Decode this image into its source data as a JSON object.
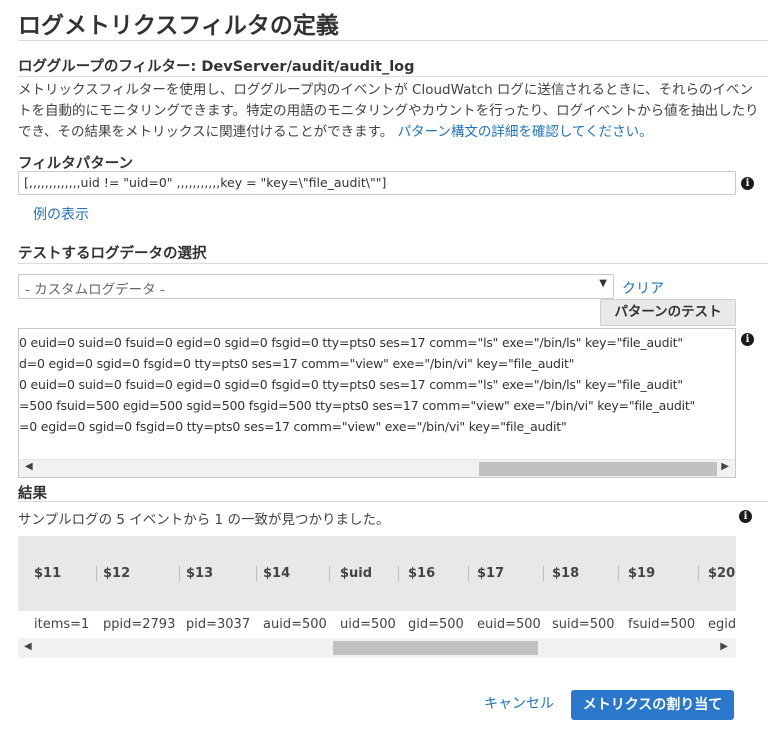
{
  "title": "ログメトリクスフィルタの定義",
  "filter_header": "ロググループのフィルター: DevServer/audit/audit_log",
  "description": "メトリックスフィルターを使用し、ロググループ内のイベントが CloudWatch ログに送信されるときに、それらのイベントを自動的にモニタリングできます。特定の用語のモニタリングやカウントを行ったり、ログイベントから値を抽出したりでき、その結果をメトリックスに関連付けることができます。",
  "description_link": "パターン構文の詳細を確認してください。",
  "filter_pattern": {
    "label": "フィルタパターン",
    "value": "[,,,,,,,,,,,,,uid != \"uid=0\" ,,,,,,,,,,,key = \"key=\\\"file_audit\\\"\"]",
    "examples_link": "例の表示"
  },
  "test_section": {
    "label": "テストするログデータの選択",
    "select_value": "- カスタムログデータ -",
    "clear_link": "クリア",
    "test_button": "パターンのテスト",
    "log_lines": [
      "0 euid=0 suid=0 fsuid=0 egid=0 sgid=0 fsgid=0 tty=pts0 ses=17 comm=\"ls\" exe=\"/bin/ls\" key=\"file_audit\"",
      "d=0 egid=0 sgid=0 fsgid=0 tty=pts0 ses=17 comm=\"view\" exe=\"/bin/vi\" key=\"file_audit\"",
      "0 euid=0 suid=0 fsuid=0 egid=0 sgid=0 fsgid=0 tty=pts0 ses=17 comm=\"ls\" exe=\"/bin/ls\" key=\"file_audit\"",
      "=500 fsuid=500 egid=500 sgid=500 fsgid=500 tty=pts0 ses=17 comm=\"view\" exe=\"/bin/vi\" key=\"file_audit\"",
      "=0 egid=0 sgid=0 fsgid=0 tty=pts0 ses=17 comm=\"view\" exe=\"/bin/vi\" key=\"file_audit\""
    ]
  },
  "results": {
    "label": "結果",
    "summary": "サンプルログの 5 イベントから 1 の一致が見つかりました。",
    "columns": [
      "$11",
      "$12",
      "$13",
      "$14",
      "$uid",
      "$16",
      "$17",
      "$18",
      "$19",
      "$20"
    ],
    "row": [
      "items=1",
      "ppid=2793",
      "pid=3037",
      "auid=500",
      "uid=500",
      "gid=500",
      "euid=500",
      "suid=500",
      "fsuid=500",
      "egid="
    ]
  },
  "footer": {
    "cancel": "キャンセル",
    "assign": "メトリクスの割り当て"
  },
  "colors": {
    "link": "#2073c0",
    "primary": "#2a78cc"
  }
}
